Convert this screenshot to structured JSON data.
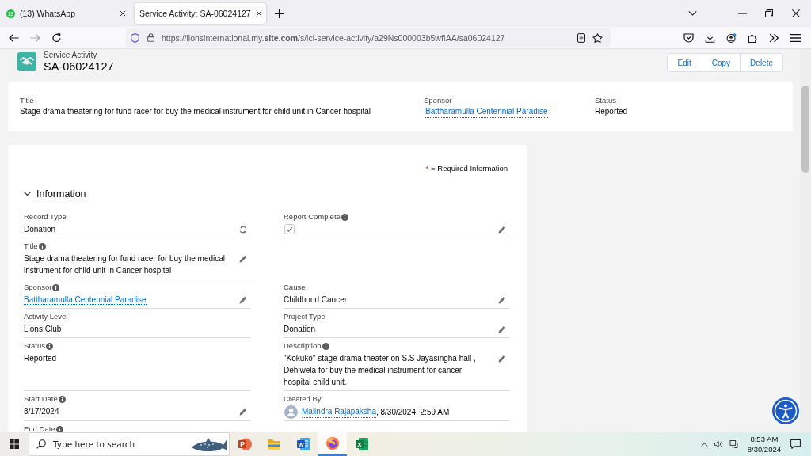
{
  "browser": {
    "tabs": [
      {
        "badge": "13",
        "label": "(13) WhatsApp",
        "selected": false
      },
      {
        "label": "Service Activity: SA-06024127",
        "selected": true
      }
    ],
    "url": "https://lionsinternational.my.**site.com**/s/lci-service-activity/a29Ns000003b5wfIAA/sa06024127"
  },
  "record": {
    "object_type": "Service Activity",
    "name": "SA-06024127",
    "actions": [
      "Edit",
      "Copy",
      "Delete"
    ]
  },
  "highlights": [
    {
      "label": "Title",
      "value": "Stage drama theatering for fund racer for buy the medical instrument for child unit in Cancer hospital",
      "kind": "text"
    },
    {
      "label": "Sponsor",
      "value": "Battharamulla Centennial Paradise",
      "kind": "link"
    },
    {
      "label": "Status",
      "value": "Reported",
      "kind": "text"
    }
  ],
  "detail": {
    "required_mark": "*",
    "required_note": "= Required Information",
    "section": {
      "title": "Information",
      "expanded": true
    },
    "rows": [
      {
        "left": {
          "label": "Record Type",
          "info": false,
          "kind": "record_type",
          "value": "Donation",
          "editable": false
        },
        "right": {
          "label": "Report Complete",
          "info": true,
          "kind": "checkbox",
          "checked": true,
          "editable": true
        }
      },
      {
        "left": {
          "label": "Title",
          "info": true,
          "kind": "text",
          "value": "Stage drama theatering for fund racer for buy the medical instrument for child unit in Cancer hospital",
          "editable": true
        }
      },
      {
        "left": {
          "label": "Sponsor",
          "info": true,
          "kind": "link",
          "value": "Battharamulla Centennial Paradise",
          "editable": true
        },
        "right": {
          "label": "Cause",
          "info": false,
          "kind": "text",
          "value": "Childhood Cancer",
          "editable": true
        }
      },
      {
        "left": {
          "label": "Activity Level",
          "info": false,
          "kind": "text",
          "value": "Lions Club",
          "editable": false
        },
        "right": {
          "label": "Project Type",
          "info": false,
          "kind": "text",
          "value": "Donation",
          "editable": true
        }
      },
      {
        "left": {
          "label": "Status",
          "info": true,
          "kind": "text",
          "value": "Reported",
          "editable": false
        },
        "right": {
          "label": "Description",
          "info": true,
          "kind": "text",
          "value": "\"Kokuko\" stage drama theater on S.S Jayasingha hall , Dehiwela for buy the medical instrument for cancer hospital child unit.",
          "editable": true
        }
      },
      {
        "left": {
          "label": "Start Date",
          "info": true,
          "kind": "text",
          "value": "8/17/2024",
          "editable": true
        },
        "right": {
          "label": "Created By",
          "info": false,
          "kind": "user",
          "value": "Malindra Rajapaksha",
          "suffix": ", 8/30/2024, 2:59 AM",
          "editable": false
        }
      },
      {
        "left": {
          "label": "End Date",
          "info": true,
          "kind": "text"
        }
      }
    ]
  },
  "taskbar": {
    "search": {
      "placeholder": "Type here to search"
    },
    "apps": [
      {
        "kind": "presentation",
        "letter": "P",
        "selected": false
      },
      {
        "kind": "folder",
        "selected": false
      },
      {
        "kind": "document",
        "letter": "W",
        "selected": false
      },
      {
        "kind": "browser",
        "selected": true
      },
      {
        "kind": "spreadsheet",
        "letter": "X",
        "selected": false
      }
    ],
    "time": "8:53 AM",
    "date": "8/30/2024"
  }
}
